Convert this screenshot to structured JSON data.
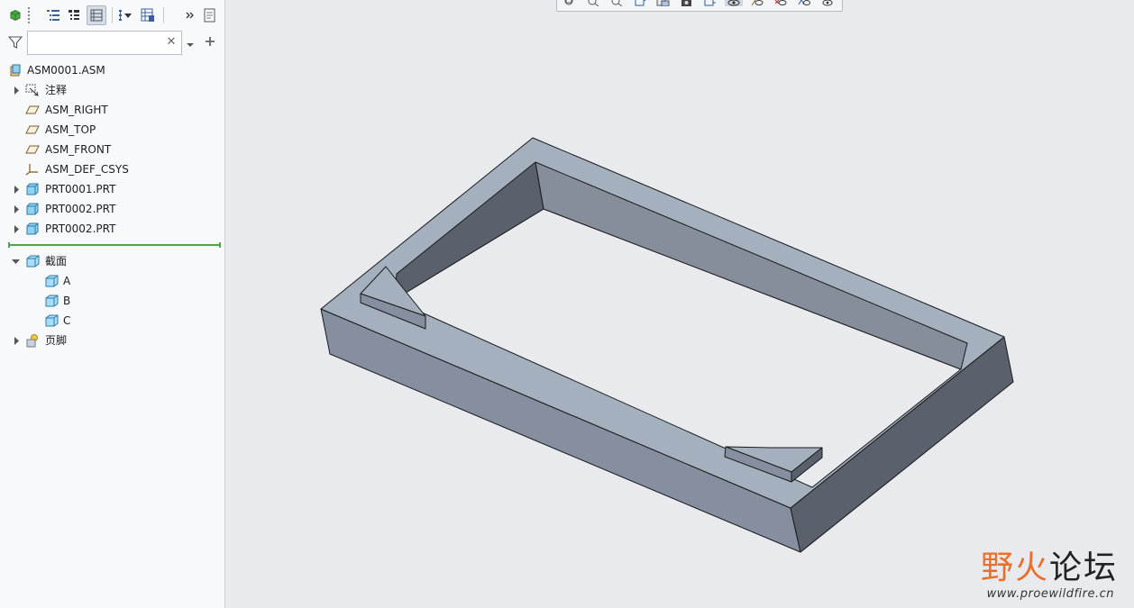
{
  "panel": {
    "toolbar": {
      "icons": [
        "model-cube-icon",
        "tree-view-icon",
        "tree-collapse-icon",
        "tree-settings-icon",
        "tree-filter-icon",
        "tree-columns-icon",
        "more-icon",
        "show-icon"
      ]
    },
    "search": {
      "value": "",
      "placeholder": ""
    }
  },
  "tree": {
    "items": [
      {
        "label": "ASM0001.ASM",
        "icon": "assembly-icon"
      },
      {
        "label": "注释",
        "icon": "annotation-icon"
      },
      {
        "label": "ASM_RIGHT",
        "icon": "datum-plane-icon"
      },
      {
        "label": "ASM_TOP",
        "icon": "datum-plane-icon"
      },
      {
        "label": "ASM_FRONT",
        "icon": "datum-plane-icon"
      },
      {
        "label": "ASM_DEF_CSYS",
        "icon": "csys-icon"
      },
      {
        "label": "PRT0001.PRT",
        "icon": "part-icon"
      },
      {
        "label": "PRT0002.PRT",
        "icon": "part-icon"
      },
      {
        "label": "PRT0002.PRT",
        "icon": "part-icon"
      },
      {
        "label": "截面",
        "icon": "section-icon"
      },
      {
        "label": "A",
        "icon": "section-icon"
      },
      {
        "label": "B",
        "icon": "section-icon"
      },
      {
        "label": "C",
        "icon": "section-icon"
      },
      {
        "label": "页脚",
        "icon": "footer-icon"
      }
    ]
  },
  "view_toolbar": {
    "icons": [
      "refit-icon",
      "zoom-in-icon",
      "zoom-out-icon",
      "repaint-icon",
      "saved-views-icon",
      "display-style-icon",
      "perspective-icon",
      "view-manager-icon",
      "datum-display-icon",
      "plane-display-icon",
      "axis-display-icon",
      "point-display-icon",
      "csys-display-icon"
    ]
  },
  "colors": {
    "model_top": "#a4b0be",
    "model_front": "#868fa0",
    "model_dark": "#5b616c",
    "model_inner": "#868e9b",
    "edge": "#1a1a1a",
    "tree_divider": "#4aa84a"
  },
  "watermark": {
    "title_part1": "野火",
    "title_part2": "论坛",
    "url": "www.proewildfire.cn"
  }
}
